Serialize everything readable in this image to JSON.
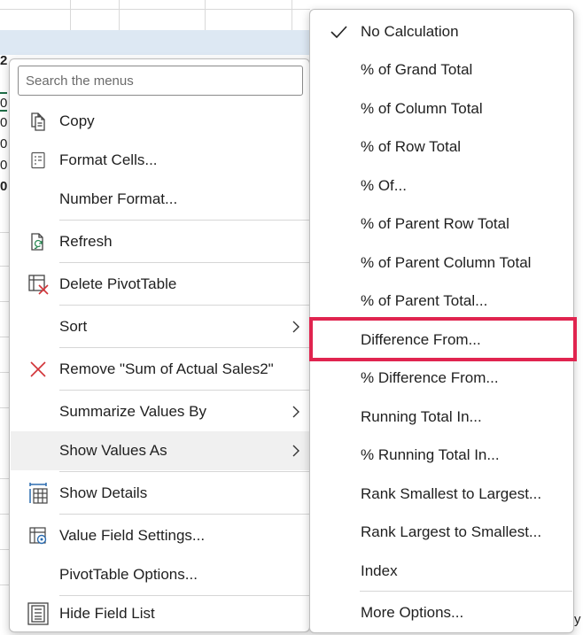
{
  "sheet": {
    "row_fragments": [
      "2",
      "0",
      "0",
      "0",
      "0",
      "0"
    ],
    "right_strip_text": "y"
  },
  "context_menu": {
    "search_placeholder": "Search the menus",
    "items": [
      {
        "id": "copy",
        "label": "Copy",
        "icon": "copy-icon"
      },
      {
        "id": "format-cells",
        "label": "Format Cells...",
        "icon": "format-cells-icon"
      },
      {
        "id": "number-format",
        "label": "Number Format...",
        "icon": ""
      },
      {
        "id": "refresh",
        "label": "Refresh",
        "icon": "refresh-icon"
      },
      {
        "id": "delete-pivottable",
        "label": "Delete PivotTable",
        "icon": "delete-pivottable-icon"
      },
      {
        "id": "sort",
        "label": "Sort",
        "icon": "",
        "submenu": true
      },
      {
        "id": "remove-field",
        "label": "Remove \"Sum of Actual Sales2\"",
        "icon": "remove-x-icon"
      },
      {
        "id": "summarize-values-by",
        "label": "Summarize Values By",
        "icon": "",
        "submenu": true
      },
      {
        "id": "show-values-as",
        "label": "Show Values As",
        "icon": "",
        "submenu": true,
        "highlighted": true
      },
      {
        "id": "show-details",
        "label": "Show Details",
        "icon": "show-details-icon"
      },
      {
        "id": "value-field-settings",
        "label": "Value Field Settings...",
        "icon": "value-field-settings-icon"
      },
      {
        "id": "pivottable-options",
        "label": "PivotTable Options...",
        "icon": ""
      },
      {
        "id": "hide-field-list",
        "label": "Hide Field List",
        "icon": "field-list-icon"
      }
    ]
  },
  "show_values_as_submenu": {
    "items": [
      {
        "label": "No Calculation",
        "checked": true
      },
      {
        "label": "% of Grand Total"
      },
      {
        "label": "% of Column Total"
      },
      {
        "label": "% of Row Total"
      },
      {
        "label": "% Of..."
      },
      {
        "label": "% of Parent Row Total"
      },
      {
        "label": "% of Parent Column Total"
      },
      {
        "label": "% of Parent Total..."
      },
      {
        "label": "Difference From...",
        "emphasized": true
      },
      {
        "label": "% Difference From..."
      },
      {
        "label": "Running Total In..."
      },
      {
        "label": "% Running Total In..."
      },
      {
        "label": "Rank Smallest to Largest..."
      },
      {
        "label": "Rank Largest to Smallest..."
      },
      {
        "label": "Index"
      },
      {
        "label": "More Options..."
      }
    ]
  },
  "colors": {
    "highlight_border": "#e0244f",
    "remove_icon": "#d13438",
    "refresh_icon_green": "#2e8b57",
    "pivot_band": "#dde8f3",
    "active_cell_border": "#1e6e47"
  }
}
